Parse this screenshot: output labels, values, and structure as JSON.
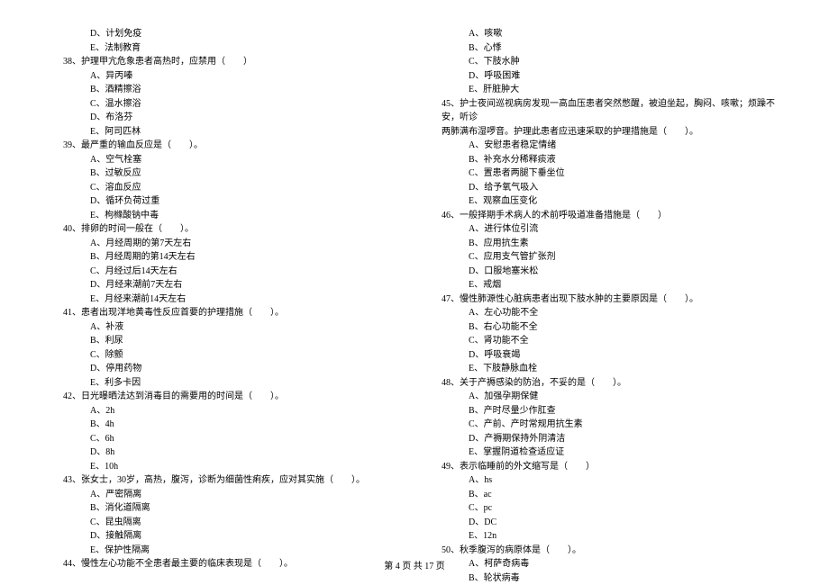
{
  "left_column": [
    {
      "type": "option",
      "text": "D、计划免疫"
    },
    {
      "type": "option",
      "text": "E、法制教育"
    },
    {
      "type": "question",
      "text": "38、护理甲亢危象患者高热时，应禁用（　　）"
    },
    {
      "type": "option",
      "text": "A、异丙嗪"
    },
    {
      "type": "option",
      "text": "B、酒精擦浴"
    },
    {
      "type": "option",
      "text": "C、温水擦浴"
    },
    {
      "type": "option",
      "text": "D、布洛芬"
    },
    {
      "type": "option",
      "text": "E、阿司匹林"
    },
    {
      "type": "question",
      "text": "39、最严重的输血反应是（　　）。"
    },
    {
      "type": "option",
      "text": "A、空气栓塞"
    },
    {
      "type": "option",
      "text": "B、过敏反应"
    },
    {
      "type": "option",
      "text": "C、溶血反应"
    },
    {
      "type": "option",
      "text": "D、循环负荷过重"
    },
    {
      "type": "option",
      "text": "E、枸橼酸钠中毒"
    },
    {
      "type": "question",
      "text": "40、排卵的时间一般在（　　）。"
    },
    {
      "type": "option",
      "text": "A、月经周期的第7天左右"
    },
    {
      "type": "option",
      "text": "B、月经周期的第14天左右"
    },
    {
      "type": "option",
      "text": "C、月经过后14天左右"
    },
    {
      "type": "option",
      "text": "D、月经来潮前7天左右"
    },
    {
      "type": "option",
      "text": "E、月经来潮前14天左右"
    },
    {
      "type": "question",
      "text": "41、患者出现洋地黄毒性反应首要的护理措施（　　）。"
    },
    {
      "type": "option",
      "text": "A、补液"
    },
    {
      "type": "option",
      "text": "B、利尿"
    },
    {
      "type": "option",
      "text": "C、除颤"
    },
    {
      "type": "option",
      "text": "D、停用药物"
    },
    {
      "type": "option",
      "text": "E、利多卡因"
    },
    {
      "type": "question",
      "text": "42、日光曝晒法达到消毒目的需要用的时间是（　　）。"
    },
    {
      "type": "option",
      "text": "A、2h"
    },
    {
      "type": "option",
      "text": "B、4h"
    },
    {
      "type": "option",
      "text": "C、6h"
    },
    {
      "type": "option",
      "text": "D、8h"
    },
    {
      "type": "option",
      "text": "E、10h"
    },
    {
      "type": "question",
      "text": "43、张女士，30岁，高热，腹泻，诊断为细菌性痢疾，应对其实施（　　）。"
    },
    {
      "type": "option",
      "text": "A、严密隔离"
    },
    {
      "type": "option",
      "text": "B、消化道隔离"
    },
    {
      "type": "option",
      "text": "C、昆虫隔离"
    },
    {
      "type": "option",
      "text": "D、接触隔离"
    },
    {
      "type": "option",
      "text": "E、保护性隔离"
    },
    {
      "type": "question",
      "text": "44、慢性左心功能不全患者最主要的临床表现是（　　）。"
    }
  ],
  "right_column": [
    {
      "type": "option",
      "text": "A、咳嗽"
    },
    {
      "type": "option",
      "text": "B、心悸"
    },
    {
      "type": "option",
      "text": "C、下肢水肿"
    },
    {
      "type": "option",
      "text": "D、呼吸困难"
    },
    {
      "type": "option",
      "text": "E、肝脏肿大"
    },
    {
      "type": "question",
      "text": "45、护士夜间巡视病房发现一高血压患者突然憋醒，被迫坐起，胸闷、咳嗽；烦躁不安，听诊"
    },
    {
      "type": "question-cont",
      "text": "两肺满布湿啰音。护理此患者应迅速采取的护理措施是（　　）。"
    },
    {
      "type": "option",
      "text": "A、安慰患者稳定情绪"
    },
    {
      "type": "option",
      "text": "B、补充水分稀释痰液"
    },
    {
      "type": "option",
      "text": "C、置患者两腿下垂坐位"
    },
    {
      "type": "option",
      "text": "D、给予氧气吸入"
    },
    {
      "type": "option",
      "text": "E、观察血压变化"
    },
    {
      "type": "question",
      "text": "46、一般择期手术病人的术前呼吸道准备措施是（　　）"
    },
    {
      "type": "option",
      "text": "A、进行体位引流"
    },
    {
      "type": "option",
      "text": "B、应用抗生素"
    },
    {
      "type": "option",
      "text": "C、应用支气管扩张剂"
    },
    {
      "type": "option",
      "text": "D、口服地塞米松"
    },
    {
      "type": "option",
      "text": "E、戒烟"
    },
    {
      "type": "question",
      "text": "47、慢性肺源性心脏病患者出现下肢水肿的主要原因是（　　）。"
    },
    {
      "type": "option",
      "text": "A、左心功能不全"
    },
    {
      "type": "option",
      "text": "B、右心功能不全"
    },
    {
      "type": "option",
      "text": "C、肾功能不全"
    },
    {
      "type": "option",
      "text": "D、呼吸衰竭"
    },
    {
      "type": "option",
      "text": "E、下肢静脉血栓"
    },
    {
      "type": "question",
      "text": "48、关于产褥感染的防治，不妥的是（　　）。"
    },
    {
      "type": "option",
      "text": "A、加强孕期保健"
    },
    {
      "type": "option",
      "text": "B、产时尽量少作肛查"
    },
    {
      "type": "option",
      "text": "C、产前、产时常规用抗生素"
    },
    {
      "type": "option",
      "text": "D、产褥期保持外阴清洁"
    },
    {
      "type": "option",
      "text": "E、掌握阴道检查适应证"
    },
    {
      "type": "question",
      "text": "49、表示临睡前的外文缩写是（　　）"
    },
    {
      "type": "option",
      "text": "A、hs"
    },
    {
      "type": "option",
      "text": "B、ac"
    },
    {
      "type": "option",
      "text": "C、pc"
    },
    {
      "type": "option",
      "text": "D、DC"
    },
    {
      "type": "option",
      "text": "E、12n"
    },
    {
      "type": "question",
      "text": "50、秋季腹泻的病原体是（　　）。"
    },
    {
      "type": "option",
      "text": "A、柯萨奇病毒"
    },
    {
      "type": "option",
      "text": "B、轮状病毒"
    }
  ],
  "footer": {
    "page_current": "4",
    "page_total": "17",
    "text": "第 4 页 共 17 页"
  }
}
